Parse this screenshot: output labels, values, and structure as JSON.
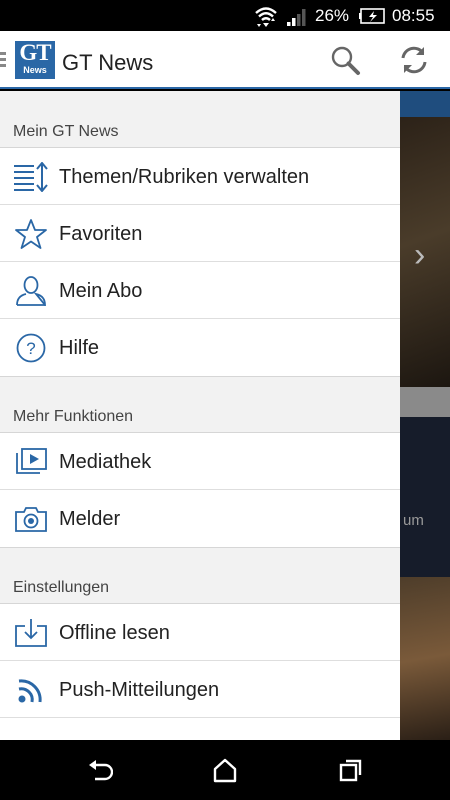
{
  "status_bar": {
    "battery_percent": "26%",
    "time": "08:55",
    "icons": [
      "wifi-icon",
      "signal-icon",
      "battery-charging-icon"
    ]
  },
  "app_bar": {
    "logo_text": "GT",
    "logo_subtext": "News",
    "title": "GT News",
    "actions": [
      "search-icon",
      "refresh-icon"
    ],
    "accent_color": "#2a67a6"
  },
  "drawer": {
    "sections": [
      {
        "header": "Mein GT News",
        "items": [
          {
            "label": "Themen/Rubriken verwalten",
            "icon": "manage-topics-icon"
          },
          {
            "label": "Favoriten",
            "icon": "star-icon"
          },
          {
            "label": "Mein Abo",
            "icon": "user-icon"
          },
          {
            "label": "Hilfe",
            "icon": "help-icon"
          }
        ]
      },
      {
        "header": "Mehr Funktionen",
        "items": [
          {
            "label": "Mediathek",
            "icon": "media-library-icon"
          },
          {
            "label": "Melder",
            "icon": "camera-icon"
          }
        ]
      },
      {
        "header": "Einstellungen",
        "items": [
          {
            "label": "Offline lesen",
            "icon": "download-icon"
          },
          {
            "label": "Push-Mitteilungen",
            "icon": "rss-icon"
          }
        ]
      }
    ]
  },
  "background": {
    "partial_text": "um"
  },
  "nav_bar": {
    "buttons": [
      "back-icon",
      "home-icon",
      "recents-icon"
    ]
  }
}
